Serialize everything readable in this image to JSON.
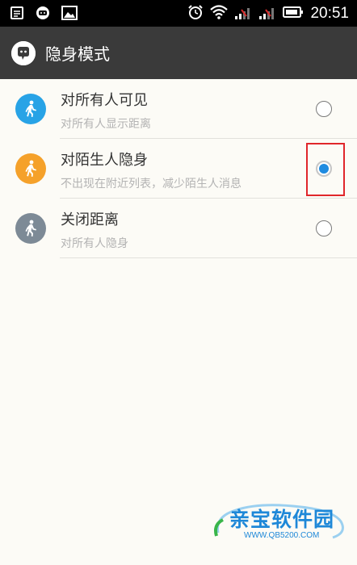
{
  "status_bar": {
    "time": "20:51",
    "icons": [
      "notification-doc-icon",
      "chat-bubble-icon",
      "image-icon",
      "alarm-icon",
      "wifi-icon",
      "signal-icon",
      "signal-icon",
      "battery-icon"
    ]
  },
  "action_bar": {
    "title": "隐身模式",
    "icon": "app-logo-icon"
  },
  "options": [
    {
      "title": "对所有人可见",
      "subtitle": "对所有人显示距离",
      "icon": "walking-person-icon",
      "icon_color": "#28a3e6",
      "selected": false
    },
    {
      "title": "对陌生人隐身",
      "subtitle": "不出现在附近列表，减少陌生人消息",
      "icon": "walking-person-icon",
      "icon_color": "#f5a12a",
      "selected": true
    },
    {
      "title": "关闭距离",
      "subtitle": "对所有人隐身",
      "icon": "walking-person-icon",
      "icon_color": "#7d8a96",
      "selected": false
    }
  ],
  "watermark": {
    "text": "亲宝软件园",
    "url": "WWW.QB5200.COM"
  },
  "colors": {
    "accent": "#1f8be0",
    "highlight_box": "#e0262b",
    "action_bar": "#3a3a3a"
  }
}
